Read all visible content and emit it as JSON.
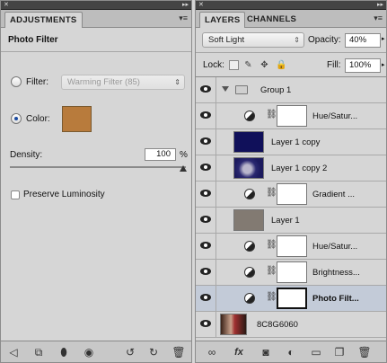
{
  "adjustments": {
    "tab": "ADJUSTMENTS",
    "title": "Photo Filter",
    "filter_label": "Filter:",
    "filter_value": "Warming Filter (85)",
    "color_label": "Color:",
    "color_swatch": "#b87b3c",
    "density_label": "Density:",
    "density_value": "100",
    "density_unit": "%",
    "density_percent": 100,
    "preserve_label": "Preserve Luminosity",
    "preserve_checked": false,
    "bottom_icons": [
      "back-arrow-icon",
      "expand-view-icon",
      "clip-icon",
      "visibility-eye-icon",
      "previous-state-icon",
      "reset-icon",
      "trash-icon"
    ]
  },
  "layers": {
    "tabs": [
      "LAYERS",
      "CHANNELS"
    ],
    "blend_mode": "Soft Light",
    "opacity_label": "Opacity:",
    "opacity_value": "40%",
    "lock_label": "Lock:",
    "fill_label": "Fill:",
    "fill_value": "100%",
    "items": [
      {
        "name": "Group 1",
        "type": "group"
      },
      {
        "name": "Hue/Satur...",
        "type": "adjustment"
      },
      {
        "name": "Layer 1 copy",
        "type": "pixel",
        "thumb": "#10105a"
      },
      {
        "name": "Layer 1 copy 2",
        "type": "pixel",
        "thumb": "#1c1a5e"
      },
      {
        "name": "Gradient ...",
        "type": "adjustment"
      },
      {
        "name": "Layer 1",
        "type": "pixel",
        "thumb": "#827a72"
      },
      {
        "name": "Hue/Satur...",
        "type": "adjustment"
      },
      {
        "name": "Brightness...",
        "type": "adjustment"
      },
      {
        "name": "Photo Filt...",
        "type": "adjustment",
        "selected": true
      },
      {
        "name": "8C8G6060",
        "type": "background",
        "thumb": "#6a3a2a"
      }
    ],
    "bottom_icons": [
      "link-layers-icon",
      "fx-icon",
      "add-mask-icon",
      "new-adjustment-icon",
      "new-group-icon",
      "new-layer-icon",
      "trash-icon"
    ]
  }
}
